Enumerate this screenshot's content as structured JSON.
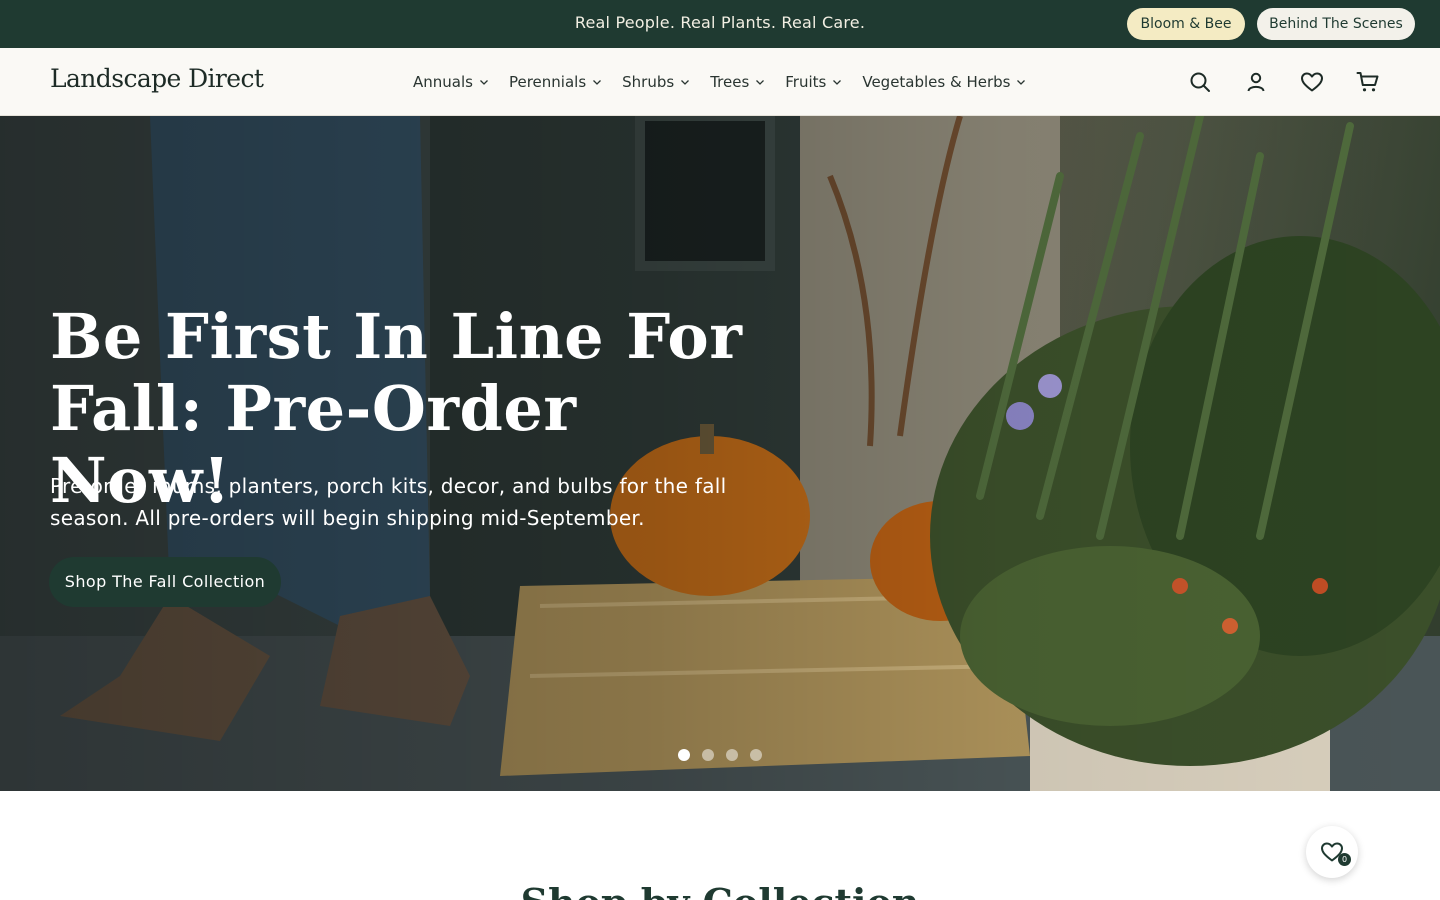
{
  "announcement": {
    "text": "Real People. Real Plants. Real Care.",
    "links": [
      {
        "label": "Bloom & Bee"
      },
      {
        "label": "Behind The Scenes"
      }
    ]
  },
  "header": {
    "logo": "Landscape Direct",
    "nav": [
      {
        "label": "Annuals"
      },
      {
        "label": "Perennials"
      },
      {
        "label": "Shrubs"
      },
      {
        "label": "Trees"
      },
      {
        "label": "Fruits"
      },
      {
        "label": "Vegetables & Herbs"
      }
    ],
    "icons": [
      "search-icon",
      "account-icon",
      "heart-icon",
      "cart-icon"
    ]
  },
  "hero": {
    "title_line1": "Be First In Line For",
    "title_line2": "Fall: Pre-Order Now!",
    "subtitle": "Pre-order mums, planters, porch kits, decor, and bulbs for the fall season. All pre-orders will begin shipping mid-September.",
    "cta": "Shop The Fall Collection",
    "slides": 4,
    "active_slide": 1
  },
  "section": {
    "heading": "Shop by Collection"
  },
  "wishlist": {
    "count": "0"
  },
  "colors": {
    "brand_dark_green": "#1f3a31",
    "bloom_pill": "#f4ebc3",
    "header_bg": "#faf9f5"
  }
}
